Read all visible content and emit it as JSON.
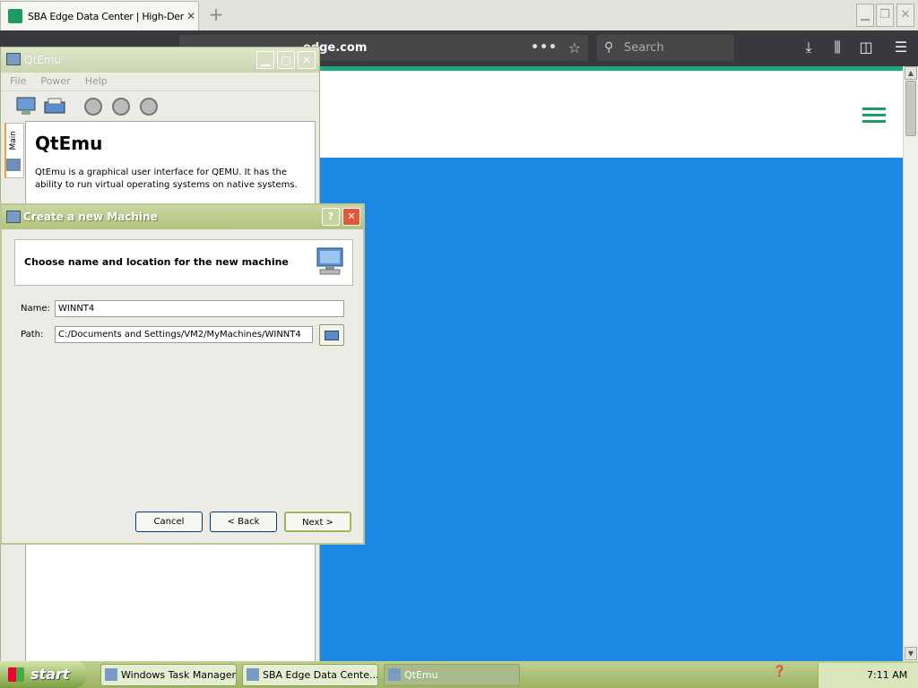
{
  "browser": {
    "tab_title": "SBA Edge Data Center | High-Dens",
    "url": "edge.com",
    "search_placeholder": "Search",
    "page_actions": "•••",
    "colors": {
      "accent": "#1aac7c",
      "hero": "#1e88e5"
    }
  },
  "qtemu": {
    "title": "QtEmu",
    "menus": [
      "File",
      "Power",
      "Help"
    ],
    "side_tab": "Main",
    "heading": "QtEmu",
    "description": "QtEmu is a graphical user interface for QEMU. It has the ability to run virtual operating systems on native systems."
  },
  "dialog": {
    "title": "Create a new Machine",
    "help": "?",
    "close": "✕",
    "header": "Choose name and location for the new machine",
    "name_label": "Name:",
    "name_value": "WINNT4",
    "path_label": "Path:",
    "path_value": "C:/Documents and Settings/VM2/MyMachines/WINNT4",
    "cancel": "Cancel",
    "back": "< Back",
    "next": "Next >"
  },
  "taskbar": {
    "start": "start",
    "tasks": [
      "Windows Task Manager",
      "SBA Edge Data Cente...",
      "QtEmu"
    ],
    "clock": "7:11 AM"
  }
}
